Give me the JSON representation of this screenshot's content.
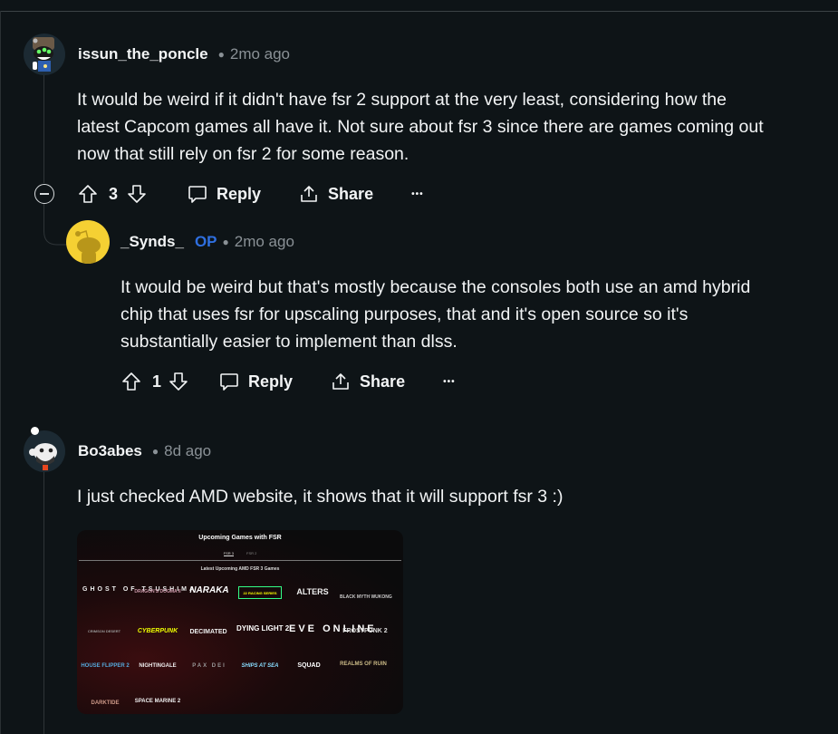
{
  "comments": [
    {
      "author": "issun_the_poncle",
      "op": false,
      "time": "2mo ago",
      "body": [
        "It would be weird if it didn't have fsr 2 support at the very least, considering how the",
        "latest Capcom games all have it. Not sure about fsr 3 since there are games coming out",
        "now that still rely on fsr 2 for some reason."
      ],
      "votes": "3",
      "reply_label": "Reply",
      "share_label": "Share",
      "more_label": "•••"
    },
    {
      "author": "_Synds_",
      "op_label": "OP",
      "time": "2mo ago",
      "body": [
        "It would be weird but that's mostly because the consoles both use an amd hybrid",
        "chip that uses fsr for upscaling purposes, that and it's open source so it's",
        "substantially easier to implement than dlss."
      ],
      "votes": "1",
      "reply_label": "Reply",
      "share_label": "Share",
      "more_label": "•••"
    },
    {
      "author": "Bo3abes",
      "time": "8d ago",
      "body": [
        "I just checked AMD website, it shows that it will support fsr 3 :)"
      ],
      "image": {
        "title": "Upcoming Games with FSR",
        "tabs": [
          "FSR 3",
          "FSR 2"
        ],
        "subtitle": "Latest Upcoming AMD FSR 3 Games",
        "games": [
          "GHOST OF TSUSHIMA",
          "DRAGON'S DOGMA II",
          "NARAKA",
          "22 RACING SERIES",
          "ALTERS",
          "BLACK MYTH WUKONG",
          "CRIMSON DESERT",
          "CYBERPUNK",
          "DECIMATED",
          "DYING LIGHT 2",
          "EVE ONLINE",
          "FROSTPUNK 2",
          "HOUSE FLIPPER 2",
          "NIGHTINGALE",
          "PAX DEI",
          "SHIPS AT SEA",
          "SQUAD",
          "REALMS OF RUIN",
          "DARKTIDE",
          "SPACE MARINE 2"
        ]
      }
    }
  ]
}
